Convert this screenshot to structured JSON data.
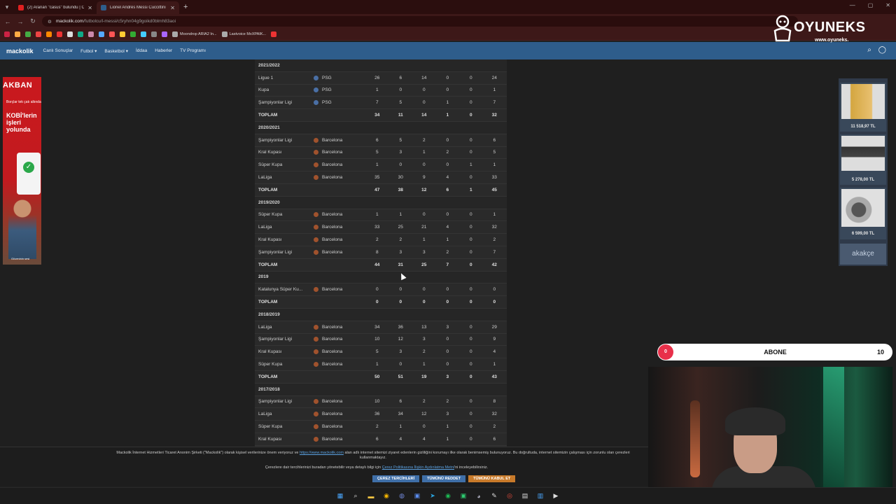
{
  "browser": {
    "tabs": [
      {
        "title": "(2) Aranan \"casus\" bulundu | C",
        "favicon_color": "#e02020",
        "active": false
      },
      {
        "title": "Lionel Andrés Messi Cuccittini",
        "favicon_color": "#2e5d8b",
        "active": true
      }
    ],
    "url_host": "mackolik.com",
    "url_path": "/futbolcu/l-messi/c5ryhn04g9goikd0blmh83aoi",
    "bookmarks": [
      {
        "label": "",
        "color": "#c24"
      },
      {
        "label": "",
        "color": "#fa4"
      },
      {
        "label": "",
        "color": "#4a4"
      },
      {
        "label": "",
        "color": "#e44"
      },
      {
        "label": "",
        "color": "#f80"
      },
      {
        "label": "",
        "color": "#e33"
      },
      {
        "label": "",
        "color": "#ddd"
      },
      {
        "label": "",
        "color": "#1a8"
      },
      {
        "label": "",
        "color": "#c8a"
      },
      {
        "label": "",
        "color": "#5af"
      },
      {
        "label": "",
        "color": "#f55"
      },
      {
        "label": "",
        "color": "#fc3"
      },
      {
        "label": "",
        "color": "#3a3"
      },
      {
        "label": "",
        "color": "#4cf"
      },
      {
        "label": "",
        "color": "#888"
      },
      {
        "label": "",
        "color": "#a6f"
      },
      {
        "label": "Moondrop ARIA2 In...",
        "color": "#aaa"
      },
      {
        "label": "Lastvoice MxXPAIK...",
        "color": "#aaa"
      },
      {
        "label": "",
        "color": "#e33"
      }
    ]
  },
  "site": {
    "logo": "mackolik",
    "nav": [
      "Canlı Sonuçlar",
      "Futbol",
      "Basketbol",
      "İddaa",
      "Haberler",
      "TV Programı"
    ],
    "accent": "#2e5d8b"
  },
  "left_ad": {
    "brand": "AKBAN",
    "line1": "Borçlar tek çatı altında",
    "line2": "KOBİ'lerin işleri yolunda",
    "footer": "Güveninin sesi"
  },
  "right_ad": {
    "prices": [
      "11 518,97 TL",
      "5 278,00 TL",
      "6 599,00 TL"
    ],
    "logo": "akakçe"
  },
  "rows": [
    {
      "kind": "season",
      "label": "2021/2022"
    },
    {
      "kind": "row",
      "comp": "Ligue 1",
      "team": "PSG",
      "vals": [
        "26",
        "6",
        "14",
        "0",
        "0",
        "24"
      ]
    },
    {
      "kind": "row",
      "comp": "Kupa",
      "team": "PSG",
      "vals": [
        "1",
        "0",
        "0",
        "0",
        "0",
        "1"
      ]
    },
    {
      "kind": "row",
      "comp": "Şampiyonlar Ligi",
      "team": "PSG",
      "vals": [
        "7",
        "5",
        "0",
        "1",
        "0",
        "7"
      ]
    },
    {
      "kind": "total",
      "comp": "TOPLAM",
      "vals": [
        "34",
        "11",
        "14",
        "1",
        "0",
        "32"
      ]
    },
    {
      "kind": "season",
      "label": "2020/2021"
    },
    {
      "kind": "row",
      "comp": "Şampiyonlar Ligi",
      "team": "Barcelona",
      "vals": [
        "6",
        "5",
        "2",
        "0",
        "0",
        "6"
      ]
    },
    {
      "kind": "row",
      "comp": "Kral Kupası",
      "team": "Barcelona",
      "vals": [
        "5",
        "3",
        "1",
        "2",
        "0",
        "5"
      ]
    },
    {
      "kind": "row",
      "comp": "Süper Kupa",
      "team": "Barcelona",
      "vals": [
        "1",
        "0",
        "0",
        "0",
        "1",
        "1"
      ]
    },
    {
      "kind": "row",
      "comp": "LaLiga",
      "team": "Barcelona",
      "vals": [
        "35",
        "30",
        "9",
        "4",
        "0",
        "33"
      ]
    },
    {
      "kind": "total",
      "comp": "TOPLAM",
      "vals": [
        "47",
        "38",
        "12",
        "6",
        "1",
        "45"
      ]
    },
    {
      "kind": "season",
      "label": "2019/2020"
    },
    {
      "kind": "row",
      "comp": "Süper Kupa",
      "team": "Barcelona",
      "vals": [
        "1",
        "1",
        "0",
        "0",
        "0",
        "1"
      ]
    },
    {
      "kind": "row",
      "comp": "LaLiga",
      "team": "Barcelona",
      "vals": [
        "33",
        "25",
        "21",
        "4",
        "0",
        "32"
      ]
    },
    {
      "kind": "row",
      "comp": "Kral Kupası",
      "team": "Barcelona",
      "vals": [
        "2",
        "2",
        "1",
        "1",
        "0",
        "2"
      ]
    },
    {
      "kind": "row",
      "comp": "Şampiyonlar Ligi",
      "team": "Barcelona",
      "vals": [
        "8",
        "3",
        "3",
        "2",
        "0",
        "7"
      ]
    },
    {
      "kind": "total",
      "comp": "TOPLAM",
      "vals": [
        "44",
        "31",
        "25",
        "7",
        "0",
        "42"
      ]
    },
    {
      "kind": "season",
      "label": "2019"
    },
    {
      "kind": "row",
      "comp": "Katalunya Süper Ku...",
      "team": "Barcelona",
      "vals": [
        "0",
        "0",
        "0",
        "0",
        "0",
        "0"
      ]
    },
    {
      "kind": "total",
      "comp": "TOPLAM",
      "vals": [
        "0",
        "0",
        "0",
        "0",
        "0",
        "0"
      ]
    },
    {
      "kind": "season",
      "label": "2018/2019"
    },
    {
      "kind": "row",
      "comp": "LaLiga",
      "team": "Barcelona",
      "vals": [
        "34",
        "36",
        "13",
        "3",
        "0",
        "29"
      ]
    },
    {
      "kind": "row",
      "comp": "Şampiyonlar Ligi",
      "team": "Barcelona",
      "vals": [
        "10",
        "12",
        "3",
        "0",
        "0",
        "9"
      ]
    },
    {
      "kind": "row",
      "comp": "Kral Kupası",
      "team": "Barcelona",
      "vals": [
        "5",
        "3",
        "2",
        "0",
        "0",
        "4"
      ]
    },
    {
      "kind": "row",
      "comp": "Süper Kupa",
      "team": "Barcelona",
      "vals": [
        "1",
        "0",
        "1",
        "0",
        "0",
        "1"
      ]
    },
    {
      "kind": "total",
      "comp": "TOPLAM",
      "vals": [
        "50",
        "51",
        "19",
        "3",
        "0",
        "43"
      ]
    },
    {
      "kind": "season",
      "label": "2017/2018"
    },
    {
      "kind": "row",
      "comp": "Şampiyonlar Ligi",
      "team": "Barcelona",
      "vals": [
        "10",
        "6",
        "2",
        "2",
        "0",
        "8"
      ]
    },
    {
      "kind": "row",
      "comp": "LaLiga",
      "team": "Barcelona",
      "vals": [
        "36",
        "34",
        "12",
        "3",
        "0",
        "32"
      ]
    },
    {
      "kind": "row",
      "comp": "Süper Kupa",
      "team": "Barcelona",
      "vals": [
        "2",
        "1",
        "0",
        "1",
        "0",
        "2"
      ]
    },
    {
      "kind": "row",
      "comp": "Kral Kupası",
      "team": "Barcelona",
      "vals": [
        "6",
        "4",
        "4",
        "1",
        "0",
        "6"
      ]
    }
  ],
  "team_colors": {
    "PSG": "#4a6fa5",
    "Barcelona": "#a0522d"
  },
  "stream": {
    "subscribe_left": "0",
    "subscribe_label": "ABONE",
    "subscribe_right": "10",
    "watermark": "OYUNEKS",
    "watermark_url": "www.oyuneks."
  },
  "cookie": {
    "text1_a": "Mackolik İnternet Hizmetleri Ticaret Anonim Şirketi (\"Mackolik\") olarak kişisel verilerinize önem veriyoruz ve",
    "link1": "https://www.mackolik.com",
    "text1_b": "alan adlı internet sitemizi ziyaret edenlerin gizliliğini korumayı ilke olarak benimsemiş bulunuyoruz. Bu doğrultuda, internet sitemizin çalışması için zorunlu olan çerezleri kullanmaktayız.",
    "text2_a": "Çerezlere dair tercihlerinizi buradan yönetebilir veya detaylı bilgi için",
    "link2": "Çerez Politikasına İlişkin Aydınlatma Metni",
    "text2_b": "'ni inceleyebilirsiniz.",
    "btn_prefs": "ÇEREZ TERCİHLERİ",
    "btn_reject": "TÜMÜNÜ REDDET",
    "btn_accept": "TÜMÜNÜ KABUL ET"
  }
}
